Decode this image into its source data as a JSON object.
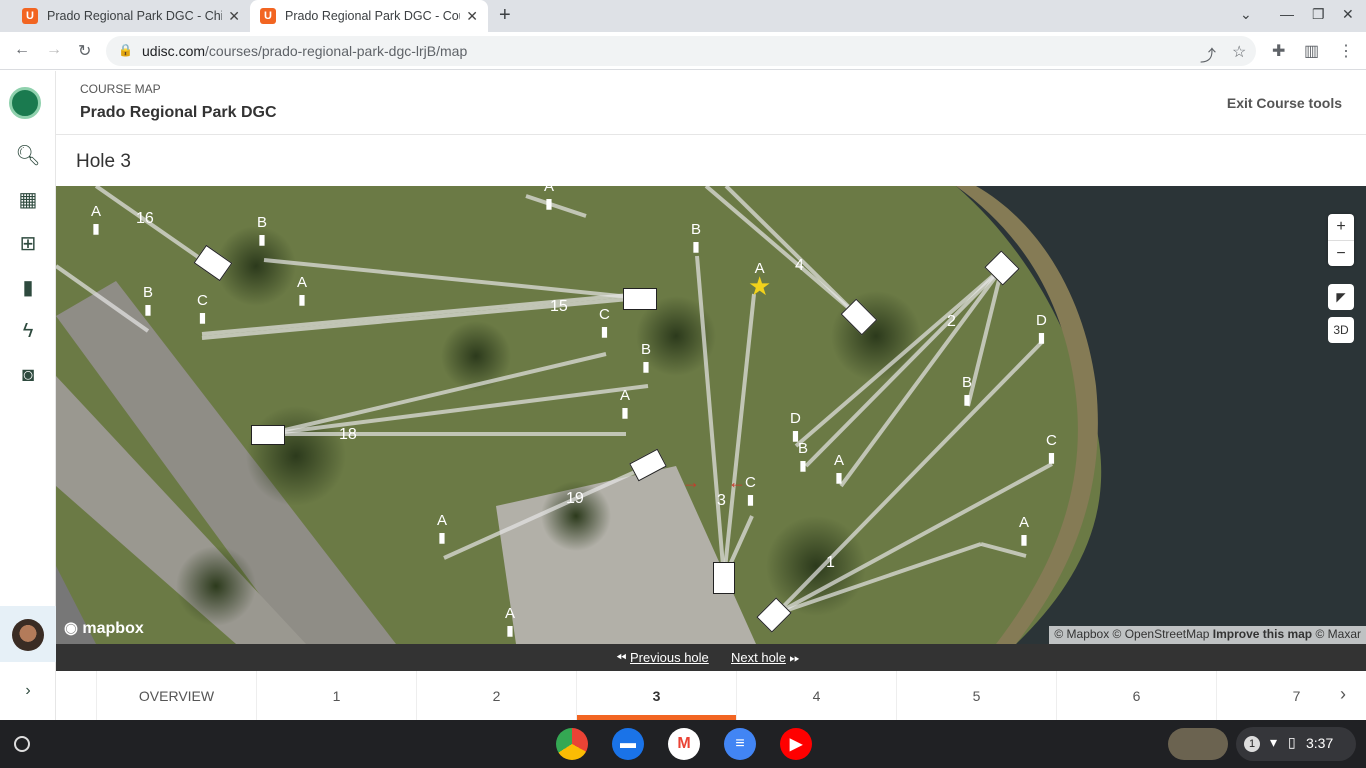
{
  "browser": {
    "tabs": [
      {
        "title": "Prado Regional Park DGC - Chin",
        "active": false
      },
      {
        "title": "Prado Regional Park DGC - Cour",
        "active": true
      }
    ],
    "url_domain": "udisc.com",
    "url_path": "/courses/prado-regional-park-dgc-lrjB/map"
  },
  "header": {
    "kicker": "COURSE MAP",
    "title": "Prado Regional Park DGC",
    "exit": "Exit Course tools"
  },
  "hole_title": "Hole 3",
  "map": {
    "zoom_in": "+",
    "zoom_out": "−",
    "three_d": "3D",
    "mapbox": "mapbox",
    "attribution_a": "© Mapbox © OpenStreetMap ",
    "attribution_b": "Improve this map",
    "attribution_c": " © Maxar",
    "hole_numbers": [
      "16",
      "15",
      "18",
      "19",
      "3",
      "4",
      "2",
      "1"
    ],
    "pin_letters": [
      "A",
      "B",
      "C",
      "A",
      "B",
      "C",
      "B",
      "A",
      "B",
      "A",
      "A",
      "D",
      "B",
      "C",
      "A",
      "D",
      "B",
      "A",
      "C",
      "A",
      "A"
    ]
  },
  "pager": {
    "prev": "Previous hole",
    "next": "Next hole"
  },
  "hole_tabs": [
    "OVERVIEW",
    "1",
    "2",
    "3",
    "4",
    "5",
    "6",
    "7"
  ],
  "active_tab": "3",
  "clock": "3:37",
  "notif_count": "1"
}
